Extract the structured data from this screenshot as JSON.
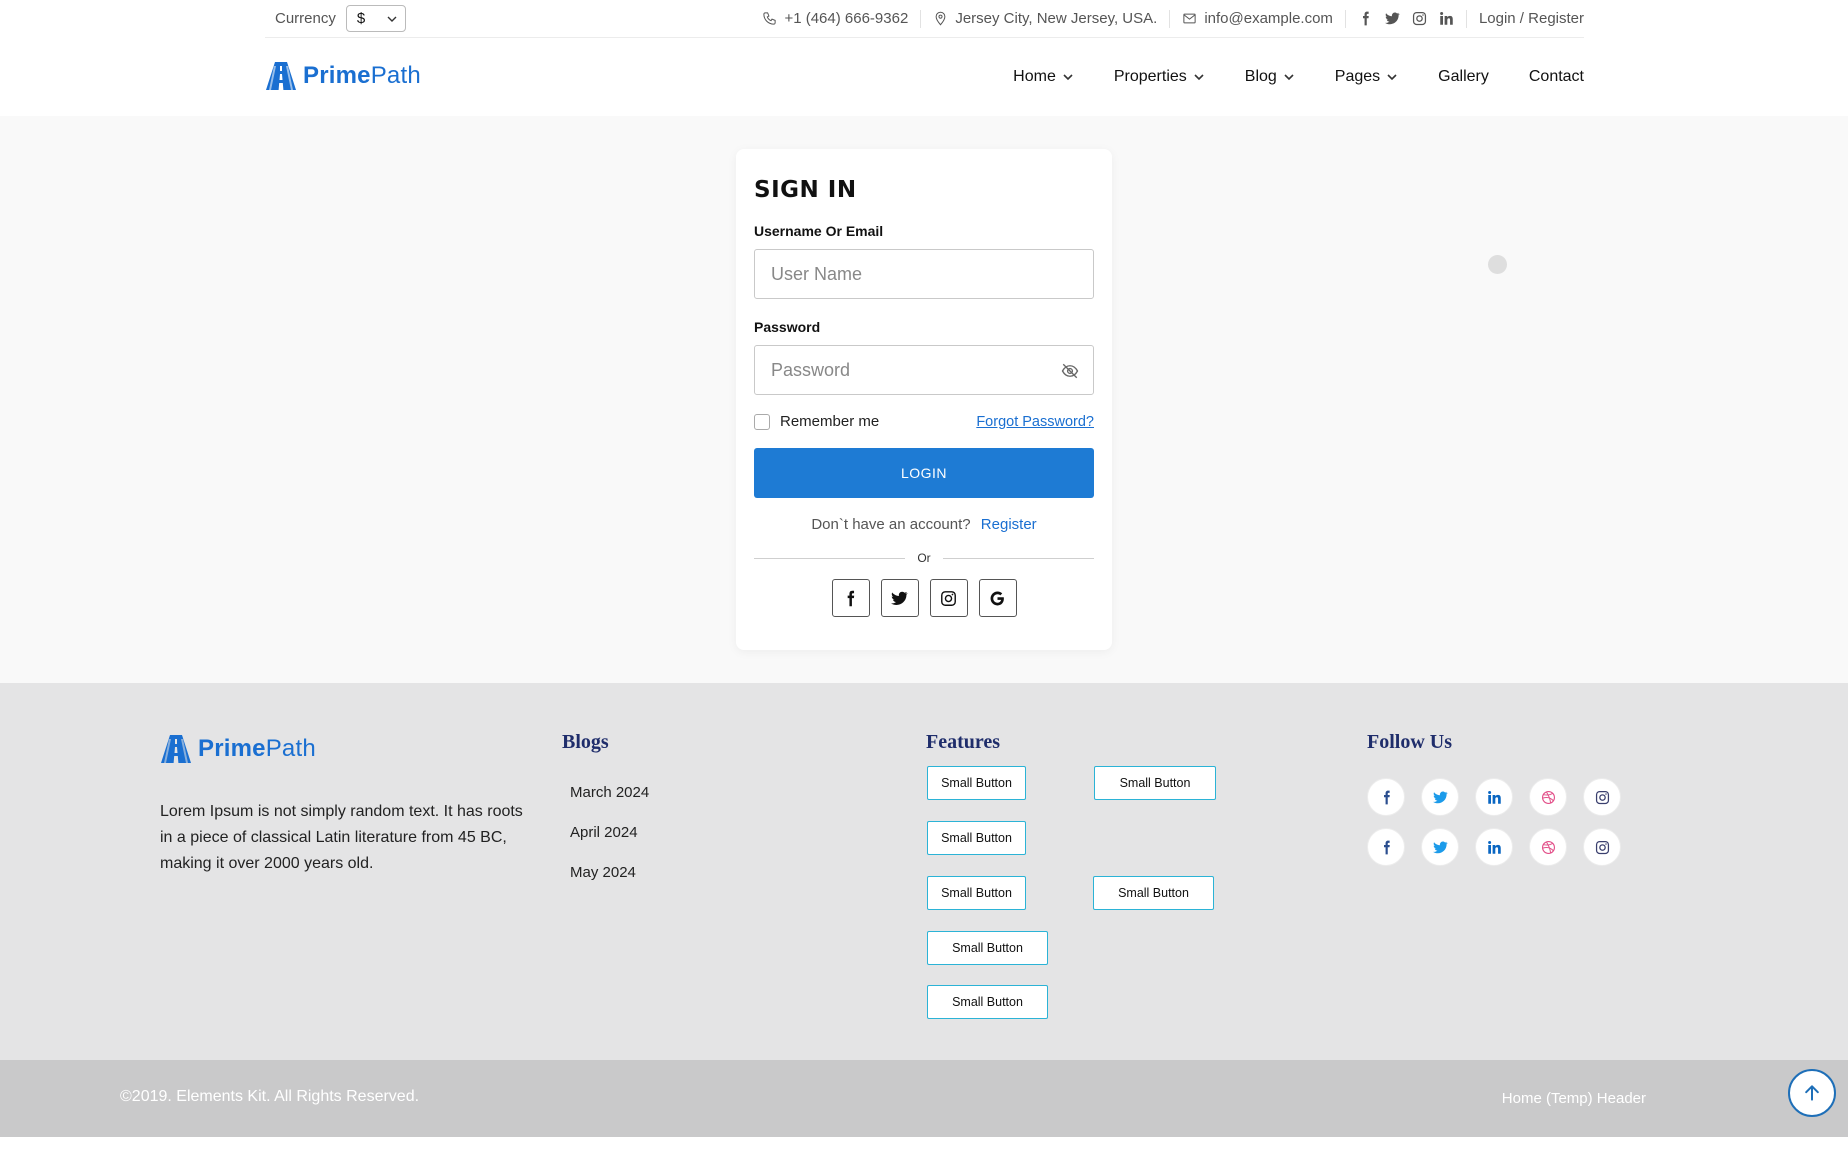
{
  "topbar": {
    "currency_label": "Currency",
    "currency_value": "$",
    "phone": "+1 (464) 666-9362",
    "address": "Jersey City, New Jersey, USA.",
    "email": "info@example.com",
    "social_icons": [
      "facebook-icon",
      "twitter-icon",
      "instagram-icon",
      "linkedin-icon"
    ],
    "auth_link": "Login / Register"
  },
  "brand": {
    "name_bold": "Prime",
    "name_light": "Path",
    "color": "#1a6fd1"
  },
  "nav": {
    "items": [
      {
        "label": "Home",
        "dropdown": true
      },
      {
        "label": "Properties",
        "dropdown": true
      },
      {
        "label": "Blog",
        "dropdown": true
      },
      {
        "label": "Pages",
        "dropdown": true
      },
      {
        "label": "Gallery",
        "dropdown": false
      },
      {
        "label": "Contact",
        "dropdown": false
      }
    ]
  },
  "signin": {
    "title": "SIGN IN",
    "username_label": "Username Or Email",
    "username_placeholder": "User Name",
    "password_label": "Password",
    "password_placeholder": "Password",
    "remember_label": "Remember me",
    "forgot_label": "Forgot Password?",
    "login_label": "LOGIN",
    "no_account_text": "Don`t have an account?",
    "register_label": "Register",
    "or_text": "Or",
    "social_buttons": [
      "facebook-icon",
      "twitter-icon",
      "instagram-icon",
      "google-icon"
    ],
    "button_color": "#1e7bd4"
  },
  "footer": {
    "description": "Lorem Ipsum is not simply random text. It has roots in a piece of classical Latin literature from 45 BC, making it over 2000 years old.",
    "blogs_title": "Blogs",
    "blogs": [
      "March 2024",
      "April 2024",
      "May 2024"
    ],
    "features_title": "Features",
    "feature_buttons": [
      "Small Button",
      "Small Button",
      "Small Button",
      "Small Button",
      "Small Button",
      "Small Button",
      "Small Button"
    ],
    "follow_title": "Follow Us",
    "follow_icons": [
      "facebook-icon",
      "twitter-icon",
      "linkedin-icon",
      "dribbble-icon",
      "instagram-icon"
    ],
    "title_color": "#1f2d6b"
  },
  "bottombar": {
    "copyright": "©2019. Elements Kit. All Rights Reserved.",
    "link": "Home (Temp) Header"
  }
}
